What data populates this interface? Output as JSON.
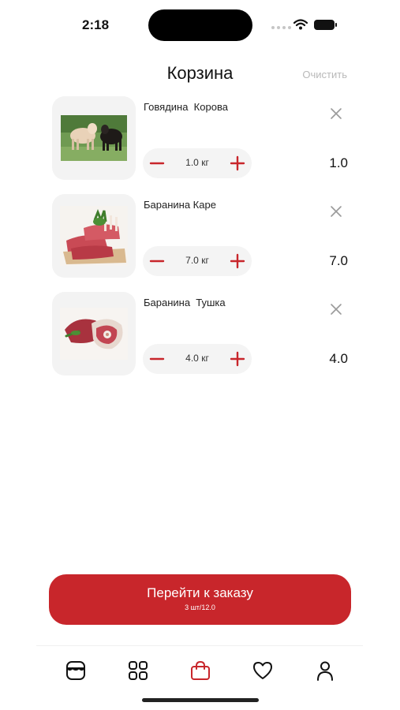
{
  "status_bar": {
    "time": "2:18"
  },
  "header": {
    "title": "Корзина",
    "clear_label": "Очистить"
  },
  "cart": {
    "items": [
      {
        "name": "Говядина  Корова",
        "quantity": "1.0 кг",
        "amount": "1.0",
        "image": "cattle-photo"
      },
      {
        "name": "Баранина Каре",
        "quantity": "7.0 кг",
        "amount": "7.0",
        "image": "lamb-rack-photo"
      },
      {
        "name": "Баранина  Тушка",
        "quantity": "4.0 кг",
        "amount": "4.0",
        "image": "lamb-carcass-photo"
      }
    ]
  },
  "checkout": {
    "label": "Перейти к заказу",
    "summary": "3 шт/12.0"
  },
  "tabs": [
    {
      "icon": "store-icon",
      "active": false
    },
    {
      "icon": "grid-icon",
      "active": false
    },
    {
      "icon": "shopping-bag-icon",
      "active": true
    },
    {
      "icon": "heart-icon",
      "active": false
    },
    {
      "icon": "profile-icon",
      "active": false
    }
  ],
  "colors": {
    "accent": "#c8262b",
    "muted": "#b9b9b9",
    "pill_bg": "#f4f4f4",
    "thumb_bg": "#f3f3f3"
  }
}
